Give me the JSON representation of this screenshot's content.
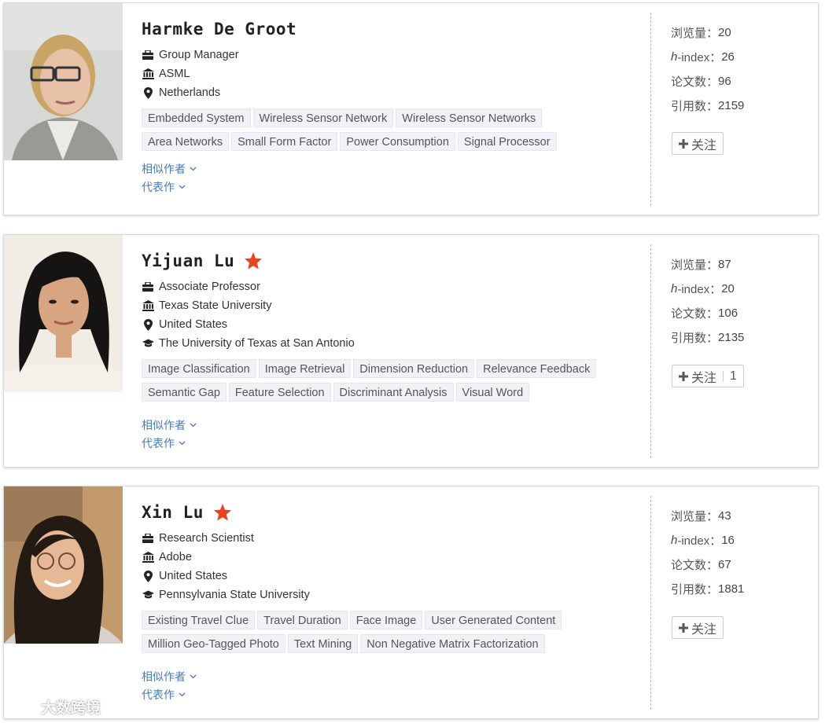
{
  "colors": {
    "accent_link": "#4a7bb5",
    "star": "#e8451e",
    "tag_bg": "#f0f2f5"
  },
  "labels": {
    "views": "浏览量：",
    "hindex_italic": "h",
    "hindex_rest": "-index：",
    "papers": "论文数：",
    "citations": "引用数：",
    "follow": "关注",
    "similar_authors": "相似作者",
    "representative_works": "代表作"
  },
  "authors": [
    {
      "name": "Harmke De Groot",
      "starred": false,
      "position": "Group Manager",
      "affiliation": "ASML",
      "location": "Netherlands",
      "education": "",
      "tags": [
        "Embedded System",
        "Wireless Sensor Network",
        "Wireless Sensor Networks",
        "Area Networks",
        "Small Form Factor",
        "Power Consumption",
        "Signal Processor"
      ],
      "views": "20",
      "hindex": "26",
      "papers": "96",
      "citations": "2159",
      "follow_count": ""
    },
    {
      "name": "Yijuan Lu",
      "starred": true,
      "position": "Associate Professor",
      "affiliation": "Texas State University",
      "location": "United States",
      "education": "The University of Texas at San Antonio",
      "tags": [
        "Image Classification",
        "Image Retrieval",
        "Dimension Reduction",
        "Relevance Feedback",
        "Semantic Gap",
        "Feature Selection",
        "Discriminant Analysis",
        "Visual Word"
      ],
      "views": "87",
      "hindex": "20",
      "papers": "106",
      "citations": "2135",
      "follow_count": "1"
    },
    {
      "name": "Xin Lu",
      "starred": true,
      "position": "Research Scientist",
      "affiliation": "Adobe",
      "location": "United States",
      "education": "Pennsylvania State University",
      "tags": [
        "Existing Travel Clue",
        "Travel Duration",
        "Face Image",
        "User Generated Content",
        "Million Geo-Tagged Photo",
        "Text Mining",
        "Non Negative Matrix Factorization"
      ],
      "views": "43",
      "hindex": "16",
      "papers": "67",
      "citations": "1881",
      "follow_count": ""
    }
  ],
  "watermark": "大数跨境"
}
